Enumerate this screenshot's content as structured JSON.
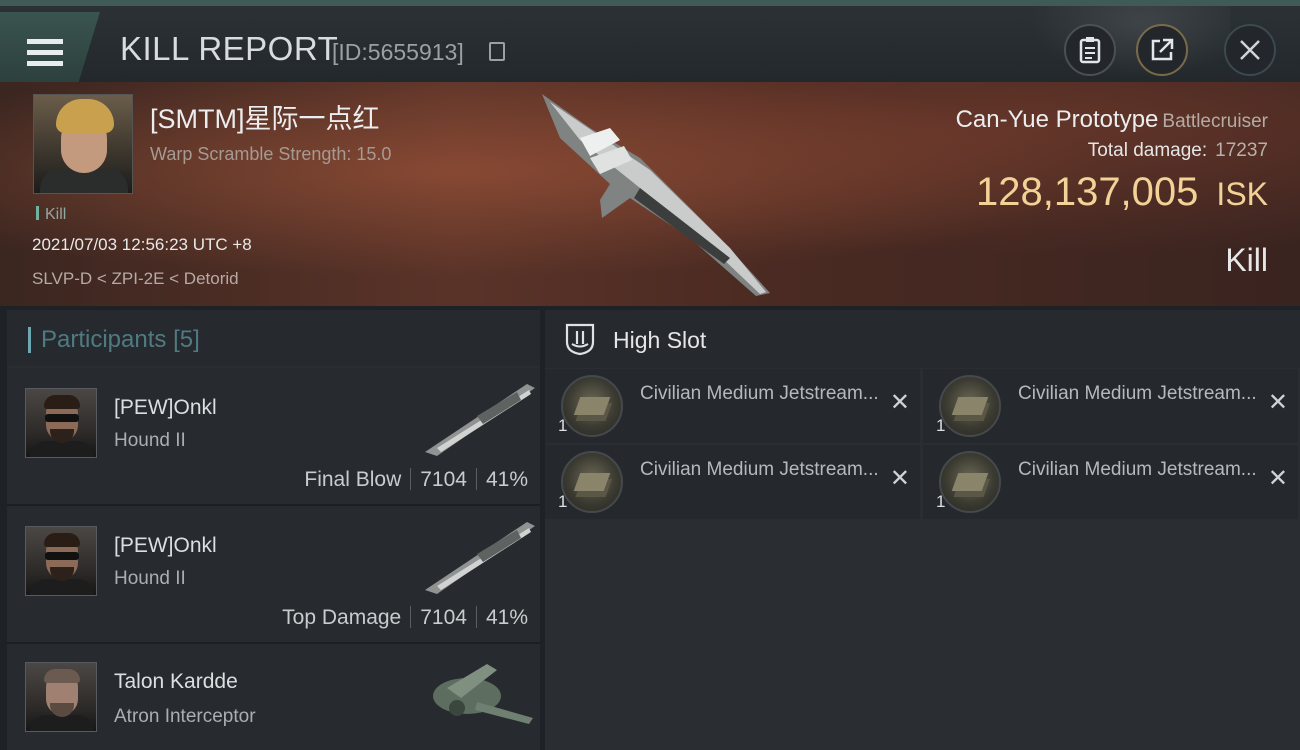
{
  "header": {
    "title": "KILL REPORT",
    "report_id": "[ID:5655913]"
  },
  "victim": {
    "name": "[SMTM]星际一点红",
    "subtitle": "Warp Scramble Strength: 15.0",
    "kill_tag": "Kill",
    "timestamp": "2021/07/03 12:56:23 UTC +8",
    "location": "SLVP-D < ZPI-2E < Detorid",
    "ship_name": "Can-Yue Prototype",
    "ship_class": "Battlecruiser",
    "total_damage_label": "Total damage:",
    "total_damage": "17237",
    "isk_value": "128,137,005",
    "isk_unit": "ISK",
    "result": "Kill"
  },
  "participants": {
    "label": "Participants",
    "count": "[5]",
    "rows": [
      {
        "name": "[PEW]Onkl",
        "ship": "Hound II",
        "role": "Final Blow",
        "damage": "7104",
        "percent": "41%"
      },
      {
        "name": "[PEW]Onkl",
        "ship": "Hound II",
        "role": "Top Damage",
        "damage": "7104",
        "percent": "41%"
      },
      {
        "name": "Talon Kardde",
        "ship": "Atron Interceptor"
      }
    ]
  },
  "slots": {
    "title": "High Slot",
    "modules": [
      {
        "name": "Civilian Medium Jetstream...",
        "qty": "1"
      },
      {
        "name": "Civilian Medium Jetstream...",
        "qty": "1"
      },
      {
        "name": "Civilian Medium Jetstream...",
        "qty": "1"
      },
      {
        "name": "Civilian Medium Jetstream...",
        "qty": "1"
      }
    ]
  }
}
